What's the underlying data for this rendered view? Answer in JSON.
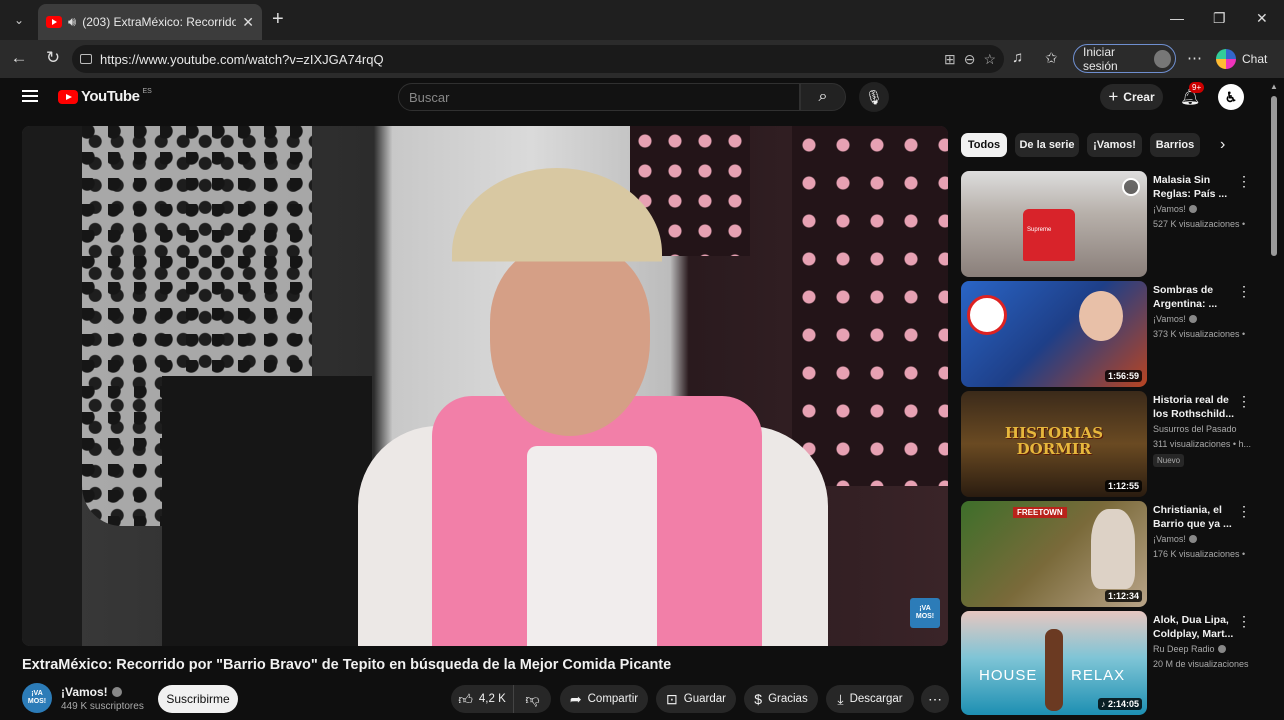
{
  "browser": {
    "tab_title": "(203) ExtraMéxico: Recorrido p",
    "url": "https://www.youtube.com/watch?v=zIXJGA74rqQ",
    "signin_label": "Iniciar sesión",
    "chat_label": "Chat"
  },
  "youtube": {
    "logo_text": "YouTube",
    "country_code": "ES",
    "search_placeholder": "Buscar",
    "create_label": "Crear",
    "notif_badge": "9+"
  },
  "video": {
    "title": "ExtraMéxico: Recorrido por \"Barrio Bravo\" de Tepito en búsqueda de la Mejor Comida Picante",
    "watermark": "¡VA MOS!",
    "channel": {
      "avatar_text": "¡VA MOS!",
      "name": "¡Vamos!",
      "subscribers": "449 K suscriptores",
      "subscribe_label": "Suscribirme"
    },
    "actions": {
      "likes": "4,2 K",
      "share": "Compartir",
      "save": "Guardar",
      "thanks": "Gracias",
      "download": "Descargar"
    }
  },
  "chips": [
    "Todos",
    "De la serie",
    "¡Vamos!",
    "Barrios"
  ],
  "recommendations": [
    {
      "title": "Malasia Sin Reglas: País ...",
      "channel": "¡Vamos!",
      "verified": true,
      "views": "527 K visualizaciones •",
      "duration": "",
      "badge": "",
      "thumb_text": "Supreme"
    },
    {
      "title": "Sombras de Argentina: ...",
      "channel": "¡Vamos!",
      "verified": true,
      "views": "373 K visualizaciones •",
      "duration": "1:56:59",
      "badge": ""
    },
    {
      "title": "Historia real de los Rothschild...",
      "channel": "Susurros del Pasado",
      "verified": false,
      "views": "311 visualizaciones • h...",
      "duration": "1:12:55",
      "badge": "Nuevo",
      "thumb_text": "HISTORIAS DORMIR"
    },
    {
      "title": "Christiania, el Barrio que ya ...",
      "channel": "¡Vamos!",
      "verified": true,
      "views": "176 K visualizaciones •",
      "duration": "1:12:34",
      "badge": "",
      "thumb_text": "FREETOWN"
    },
    {
      "title": "Alok, Dua Lipa, Coldplay, Mart...",
      "channel": "Ru Deep Radio",
      "verified": true,
      "views": "20 M de visualizaciones",
      "duration": "2:14:05",
      "badge": "",
      "thumb_text": [
        "HOUSE",
        "RELAX"
      ]
    }
  ],
  "colors": {
    "brand_red": "#ff0000",
    "background": "#0f0f0f",
    "chip_bg": "#272727"
  }
}
